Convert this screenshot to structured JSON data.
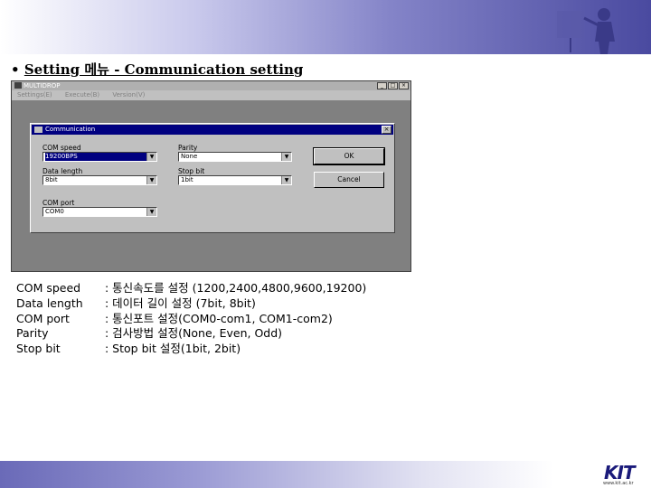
{
  "slide": {
    "bullet": "•",
    "title": "Setting 메뉴 - Communication setting"
  },
  "app_window": {
    "title": "MULTIDROP",
    "menu": [
      "Settings(E)",
      "Execute(B)",
      "Version(V)"
    ]
  },
  "dialog": {
    "title": "Communication",
    "close_glyph": "×",
    "fields": {
      "com_speed": {
        "label": "COM speed",
        "value": "19200BPS"
      },
      "data_length": {
        "label": "Data length",
        "value": "8bit"
      },
      "com_port": {
        "label": "COM port",
        "value": "COM0"
      },
      "parity": {
        "label": "Parity",
        "value": "None"
      },
      "stop_bit": {
        "label": "Stop bit",
        "value": "1bit"
      }
    },
    "ok_label": "OK",
    "cancel_label": "Cancel"
  },
  "descriptions": [
    {
      "key": "COM speed",
      "value": ": 통신속도를 설정 (1200,2400,4800,9600,19200)"
    },
    {
      "key": "Data length",
      "value": ": 데이터 길이 설정 (7bit, 8bit)"
    },
    {
      "key": "COM port",
      "value": ": 통신포트 설정(COM0-com1, COM1-com2)"
    },
    {
      "key": "Parity",
      "value": ": 검사방법 설정(None, Even, Odd)"
    },
    {
      "key": "Stop bit",
      "value": ": Stop bit 설정(1bit, 2bit)"
    }
  ],
  "footer": {
    "logo_text": "KIT",
    "logo_url": "www.kit.ac.kr"
  },
  "colors": {
    "dialog_titlebar": "#000080",
    "window_face": "#c0c0c0",
    "banner_dark": "#4a4aa0"
  }
}
